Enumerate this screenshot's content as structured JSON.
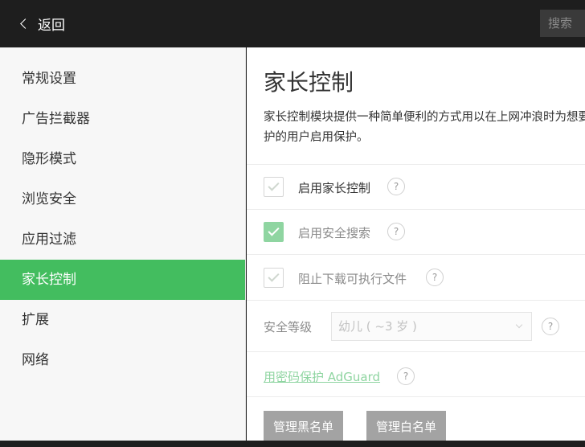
{
  "header": {
    "back_label": "返回",
    "search_label": "搜索"
  },
  "sidebar": {
    "items": [
      {
        "label": "常规设置"
      },
      {
        "label": "广告拦截器"
      },
      {
        "label": "隐形模式"
      },
      {
        "label": "浏览安全"
      },
      {
        "label": "应用过滤"
      },
      {
        "label": "家长控制",
        "active": true
      },
      {
        "label": "扩展"
      },
      {
        "label": "网络"
      }
    ]
  },
  "main": {
    "title": "家长控制",
    "description": "家长控制模块提供一种简单便利的方式用以在上网冲浪时为想要提供保护的用户启用保护。",
    "options": [
      {
        "label": "启用家长控制",
        "checked": false
      },
      {
        "label": "启用安全搜索",
        "checked": true
      },
      {
        "label": "阻止下载可执行文件",
        "checked": false
      }
    ],
    "help_glyph": "?",
    "sensitivity": {
      "label": "安全等级",
      "value": "幼儿 ( ~3 岁 )"
    },
    "password_link": "用密码保护 AdGuard",
    "buttons": {
      "blacklist": "管理黑名单",
      "whitelist": "管理白名单"
    }
  },
  "colors": {
    "accent": "#43bd5f",
    "accent_light": "#8fd5a1",
    "header_bg": "#1e1e1e",
    "button_bg": "#a3a3a3"
  }
}
